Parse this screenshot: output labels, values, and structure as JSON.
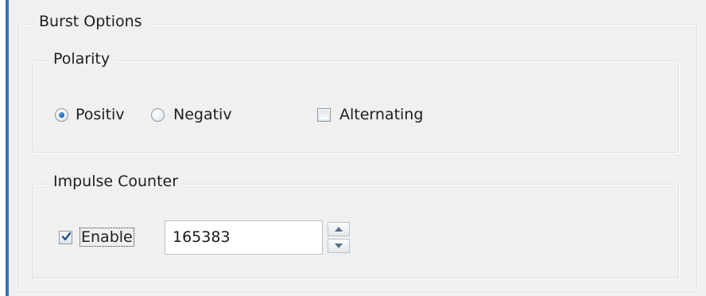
{
  "burst_options": {
    "title": "Burst Options",
    "polarity": {
      "title": "Polarity",
      "options": [
        {
          "label": "Positiv",
          "selected": true
        },
        {
          "label": "Negativ",
          "selected": false
        }
      ],
      "alternating": {
        "label": "Alternating",
        "checked": false
      }
    },
    "impulse_counter": {
      "title": "Impulse Counter",
      "enable": {
        "label": "Enable",
        "checked": true
      },
      "value": "165383"
    }
  },
  "colors": {
    "accent_border": "#3a6fb5",
    "radio_dot": "#1d5fb0",
    "check_mark": "#2a4f8f",
    "group_border": "#d5dfe5"
  },
  "icons": {
    "spin_up": "chevron-up-icon",
    "spin_down": "chevron-down-icon",
    "check": "check-icon"
  }
}
